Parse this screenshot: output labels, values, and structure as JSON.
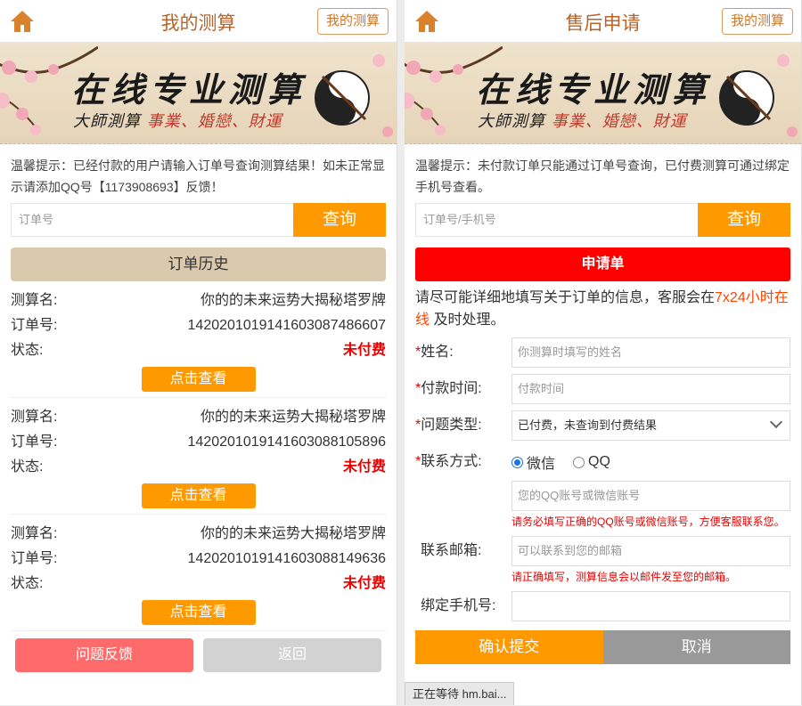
{
  "left": {
    "header": {
      "title": "我的测算",
      "my_btn": "我的测算"
    },
    "banner": {
      "main": "在线专业测算",
      "sub_prefix": "大師測算",
      "sub_red": "事業、婚戀、財運"
    },
    "tip": "温馨提示：已经付款的用户请输入订单号查询测算结果！如未正常显示请添加QQ号【1173908693】反馈！",
    "search": {
      "placeholder": "订单号",
      "button": "查询"
    },
    "history_label": "订单历史",
    "orders": [
      {
        "name_label": "测算名:",
        "name": "你的的未来运势大揭秘塔罗牌",
        "no_label": "订单号:",
        "no": "14202010191416030874866​07",
        "status_label": "状态:",
        "status": "未付费",
        "view": "点击查看"
      },
      {
        "name_label": "测算名:",
        "name": "你的的未来运势大揭秘塔罗牌",
        "no_label": "订单号:",
        "no": "142020101914160308810589​6",
        "status_label": "状态:",
        "status": "未付费",
        "view": "点击查看"
      },
      {
        "name_label": "测算名:",
        "name": "你的的未来运势大揭秘塔罗牌",
        "no_label": "订单号:",
        "no": "142020101914160308814963​6",
        "status_label": "状态:",
        "status": "未付费",
        "view": "点击查看"
      }
    ],
    "feedback": "问题反馈",
    "back": "返回"
  },
  "right": {
    "header": {
      "title": "售后申请",
      "my_btn": "我的测算"
    },
    "banner": {
      "main": "在线专业测算",
      "sub_prefix": "大師測算",
      "sub_red": "事業、婚戀、財運"
    },
    "tip": "温馨提示：未付款订单只能通过订单号查询，已付费测算可通过绑定手机号查看。",
    "search": {
      "placeholder": "订单号/手机号",
      "button": "查询"
    },
    "apply_header": "申请单",
    "intro_a": "请尽可能详细地填写关于订单的信息，客服会在",
    "intro_hl": "7x24小时在线",
    "intro_b": "及时处理。",
    "form": {
      "name_label": "姓名:",
      "name_ph": "你测算时填写的姓名",
      "paytime_label": "付款时间:",
      "paytime_ph": "付款时间",
      "type_label": "问题类型:",
      "type_value": "已付费，未查询到付费结果",
      "contact_label": "联系方式:",
      "radio_wechat": "微信",
      "radio_qq": "QQ",
      "contact_ph": "您的QQ账号或微信账号",
      "contact_hint": "请务必填写正确的QQ账号或微信账号，方便客服联系您。",
      "email_label": "联系邮箱:",
      "email_ph": "可以联系到您的邮箱",
      "email_hint": "请正确填写，测算信息会以邮件发至您的邮箱。",
      "phone_label": "绑定手机号:",
      "submit": "确认提交",
      "cancel": "取消"
    }
  },
  "status_bar": "正在等待 hm.bai...",
  "colors": {
    "accent": "#ff9900",
    "brown": "#b8642a",
    "red": "#e60000"
  }
}
